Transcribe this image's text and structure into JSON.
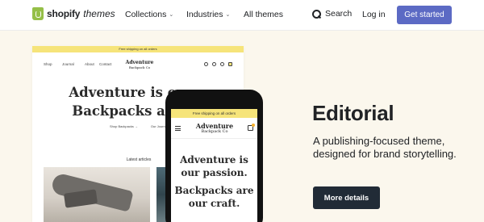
{
  "brand": {
    "name": "shopify",
    "suffix": "themes"
  },
  "nav": {
    "collections": "Collections",
    "industries": "Industries",
    "all_themes": "All themes",
    "search": "Search",
    "login": "Log in",
    "cta": "Get started"
  },
  "desktop_preview": {
    "banner": "Free shipping on all orders",
    "menu": [
      "Shop",
      "Journal",
      "About",
      "Contact"
    ],
    "store_name": "Adventure",
    "store_name_sub": "Backpack Co",
    "headline_line1": "Adventure is our p",
    "headline_line2": "Backpacks are ou",
    "links": [
      "Shop Backpacks →",
      "Our Journal →"
    ],
    "section_title": "Latest articles"
  },
  "phone_preview": {
    "banner": "Free shipping on all orders",
    "store_name": "Adventure",
    "store_name_sub": "Backpack Co",
    "headline": [
      "Adventure is",
      "our passion.",
      "Backpacks are",
      "our craft."
    ]
  },
  "theme": {
    "title": "Editorial",
    "description": "A publishing-focused theme, designed for brand storytelling.",
    "button": "More details"
  },
  "colors": {
    "hero_bg": "#fbf7ed",
    "cta": "#5c6ac4",
    "dark_button": "#212b36",
    "banner_yellow": "#f6e47a",
    "shopify_green": "#95bf47"
  }
}
